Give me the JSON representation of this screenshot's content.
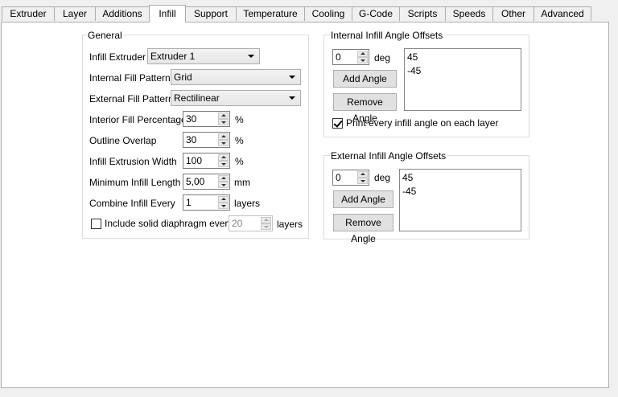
{
  "tabs": [
    "Extruder",
    "Layer",
    "Additions",
    "Infill",
    "Support",
    "Temperature",
    "Cooling",
    "G-Code",
    "Scripts",
    "Speeds",
    "Other",
    "Advanced"
  ],
  "active_tab": "Infill",
  "general": {
    "title": "General",
    "infill_extruder": {
      "label": "Infill Extruder",
      "value": "Extruder 1"
    },
    "internal_fill_pattern": {
      "label": "Internal Fill Pattern",
      "value": "Grid"
    },
    "external_fill_pattern": {
      "label": "External Fill Pattern",
      "value": "Rectilinear"
    },
    "interior_fill_percentage": {
      "label": "Interior Fill Percentage",
      "value": "30",
      "unit": "%"
    },
    "outline_overlap": {
      "label": "Outline Overlap",
      "value": "30",
      "unit": "%"
    },
    "infill_extrusion_width": {
      "label": "Infill Extrusion Width",
      "value": "100",
      "unit": "%"
    },
    "minimum_infill_length": {
      "label": "Minimum Infill Length",
      "value": "5,00",
      "unit": "mm"
    },
    "combine_infill_every": {
      "label": "Combine Infill Every",
      "value": "1",
      "unit": "layers"
    },
    "solid_diaphragm": {
      "label": "Include solid diaphragm every",
      "value": "20",
      "unit": "layers",
      "checked": false
    }
  },
  "internal_offsets": {
    "title": "Internal Infill Angle Offsets",
    "angle_value": "0",
    "unit": "deg",
    "add_label": "Add Angle",
    "remove_label": "Remove Angle",
    "angles": [
      "45",
      "-45"
    ],
    "print_every_label": "Print every infill angle on each layer",
    "print_every_checked": true
  },
  "external_offsets": {
    "title": "External Infill Angle Offsets",
    "angle_value": "0",
    "unit": "deg",
    "add_label": "Add Angle",
    "remove_label": "Remove Angle",
    "angles": [
      "45",
      "-45"
    ]
  }
}
